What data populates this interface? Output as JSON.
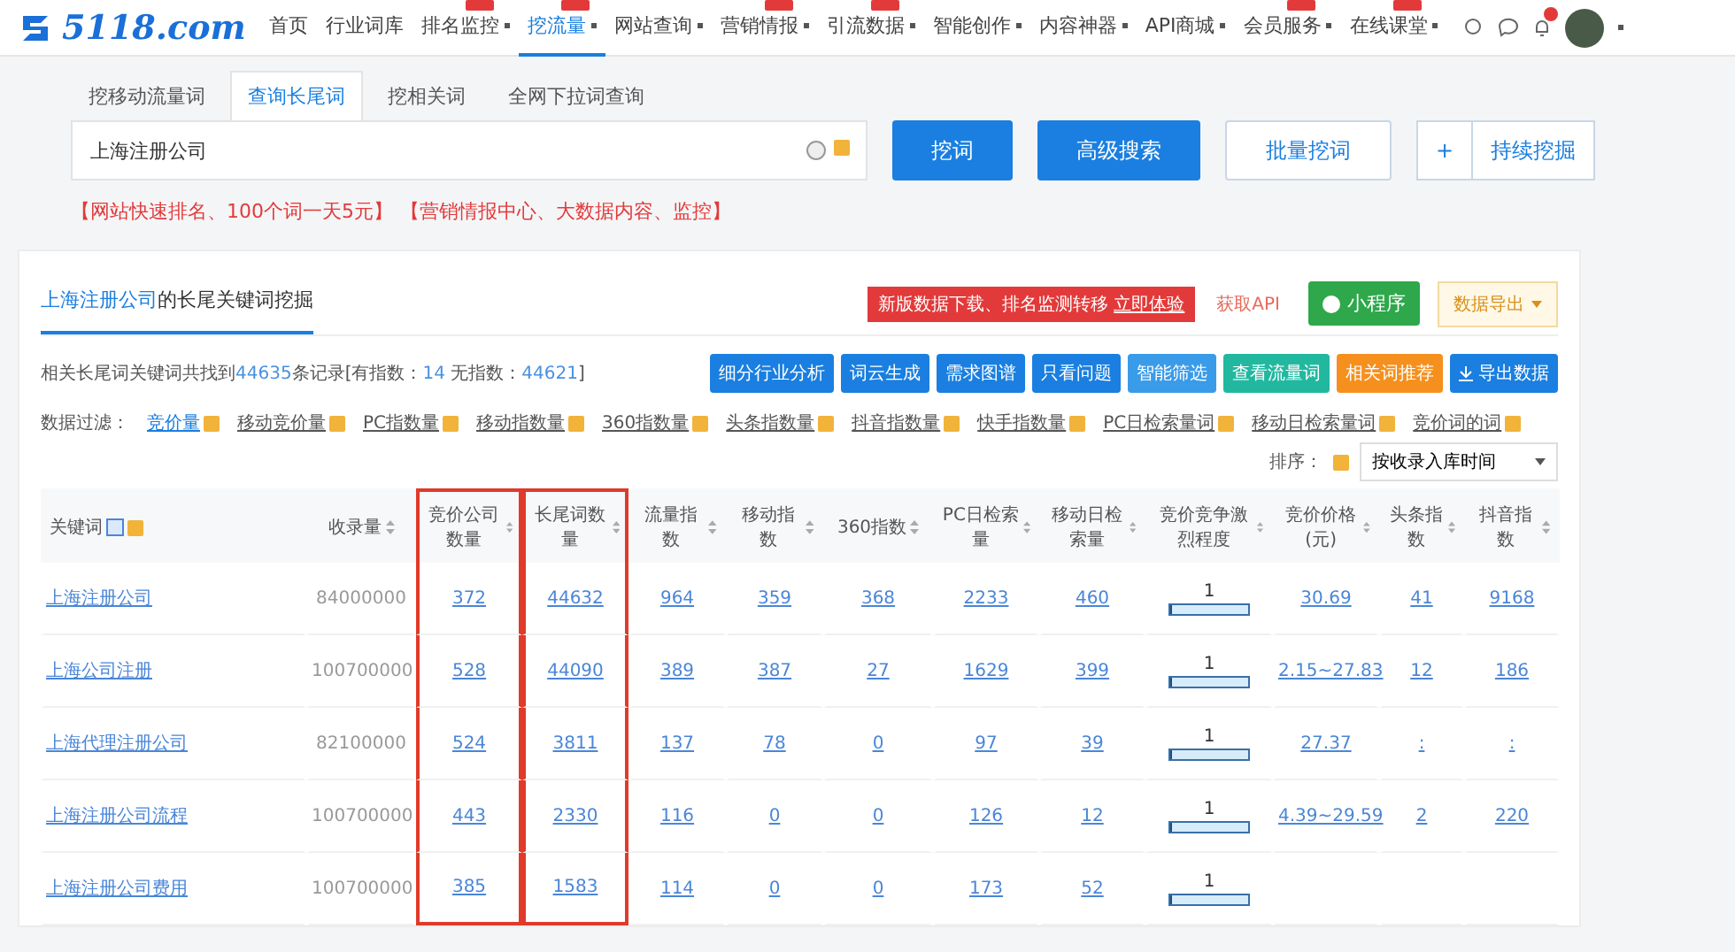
{
  "nav": {
    "logo": "5118.com",
    "items": [
      {
        "label": "首页",
        "dropdown": false,
        "badge": false,
        "selected": false
      },
      {
        "label": "行业词库",
        "dropdown": false,
        "badge": false,
        "selected": false
      },
      {
        "label": "排名监控",
        "dropdown": true,
        "badge": true,
        "selected": false
      },
      {
        "label": "挖流量",
        "dropdown": true,
        "badge": true,
        "selected": true
      },
      {
        "label": "网站查询",
        "dropdown": true,
        "badge": false,
        "selected": false
      },
      {
        "label": "营销情报",
        "dropdown": true,
        "badge": true,
        "selected": false
      },
      {
        "label": "引流数据",
        "dropdown": true,
        "badge": true,
        "selected": false
      },
      {
        "label": "智能创作",
        "dropdown": true,
        "badge": false,
        "selected": false
      },
      {
        "label": "内容神器",
        "dropdown": true,
        "badge": false,
        "selected": false
      },
      {
        "label": "API商城",
        "dropdown": true,
        "badge": false,
        "selected": false
      },
      {
        "label": "会员服务",
        "dropdown": true,
        "badge": true,
        "selected": false
      },
      {
        "label": "在线课堂",
        "dropdown": true,
        "badge": true,
        "selected": false
      }
    ]
  },
  "search_tabs": [
    {
      "label": "挖移动流量词",
      "selected": false
    },
    {
      "label": "查询长尾词",
      "selected": true
    },
    {
      "label": "挖相关词",
      "selected": false
    },
    {
      "label": "全网下拉词查询",
      "selected": false
    }
  ],
  "search": {
    "value": "上海注册公司",
    "buttons": [
      {
        "label": "挖词",
        "kind": "primary"
      },
      {
        "label": "高级搜索",
        "kind": "primary"
      },
      {
        "label": "批量挖词",
        "kind": "outline"
      }
    ],
    "add": "+",
    "continue": "持续挖掘"
  },
  "promo": [
    "【网站快速排名、100个词一天5元】",
    "【营销情报中心、大数据内容、监控】"
  ],
  "card": {
    "title_keyword": "上海注册公司",
    "title_rest": "的长尾关键词挖掘",
    "notice": "新版数据下载、排名监测转移",
    "notice_link": "立即体验",
    "api": "获取API",
    "mini": "小程序",
    "export_menu": "数据导出",
    "summary": {
      "prefix": "相关长尾词关键词共找到",
      "total": "44635",
      "middle": "条记录[有指数：",
      "indexed": "14",
      "middle2": "  无指数：",
      "unindexed": "44621",
      "suffix": "]"
    },
    "actions": [
      {
        "label": "细分行业分析",
        "color": "#1a7fe0"
      },
      {
        "label": "词云生成",
        "color": "#1a7fe0"
      },
      {
        "label": "需求图谱",
        "color": "#1a7fe0"
      },
      {
        "label": "只看问题",
        "color": "#1a7fe0"
      },
      {
        "label": "智能筛选",
        "color": "#3a9be8"
      },
      {
        "label": "查看流量词",
        "color": "#22b8a0"
      },
      {
        "label": "相关词推荐",
        "color": "#f5901e"
      },
      {
        "label": "导出数据",
        "color": "#1a7fe0"
      }
    ],
    "filter_label": "数据过滤：",
    "filters": [
      {
        "label": "竞价量",
        "selected": true
      },
      {
        "label": "移动竞价量",
        "selected": false
      },
      {
        "label": "PC指数量",
        "selected": false
      },
      {
        "label": "移动指数量",
        "selected": false
      },
      {
        "label": "360指数量",
        "selected": false
      },
      {
        "label": "头条指数量",
        "selected": false
      },
      {
        "label": "抖音指数量",
        "selected": false
      },
      {
        "label": "快手指数量",
        "selected": false
      },
      {
        "label": "PC日检索量词",
        "selected": false
      },
      {
        "label": "移动日检索量词",
        "selected": false
      },
      {
        "label": "竞价词的词",
        "selected": false
      }
    ],
    "sort_label": "排序：",
    "sort_value": "按收录入库时间"
  },
  "table": {
    "columns": [
      {
        "label": "关键词",
        "highlighted": false
      },
      {
        "label": "收录量",
        "highlighted": false
      },
      {
        "label": "竞价公司数量",
        "highlighted": true
      },
      {
        "label": "长尾词数量",
        "highlighted": true
      },
      {
        "label": "流量指数",
        "highlighted": false
      },
      {
        "label": "移动指数",
        "highlighted": false
      },
      {
        "label": "360指数",
        "highlighted": false
      },
      {
        "label": "PC日检索量",
        "highlighted": false
      },
      {
        "label": "移动日检索量",
        "highlighted": false
      },
      {
        "label": "竞价竞争激烈程度",
        "highlighted": false
      },
      {
        "label": "竞价价格(元)",
        "highlighted": false
      },
      {
        "label": "头条指数",
        "highlighted": false
      },
      {
        "label": "抖音指数",
        "highlighted": false
      }
    ],
    "rows": [
      {
        "cells": [
          "上海注册公司",
          "84000000",
          "372",
          "44632",
          "964",
          "359",
          "368",
          "2233",
          "460"
        ],
        "competition": {
          "value": "1",
          "level": 0.02
        },
        "tail": [
          "30.69",
          "41",
          "9168"
        ]
      },
      {
        "cells": [
          "上海公司注册",
          "100700000",
          "528",
          "44090",
          "389",
          "387",
          "27",
          "1629",
          "399"
        ],
        "competition": {
          "value": "1",
          "level": 0.02
        },
        "tail": [
          "2.15~27.83",
          "12",
          "186"
        ]
      },
      {
        "cells": [
          "上海代理注册公司",
          "82100000",
          "524",
          "3811",
          "137",
          "78",
          "0",
          "97",
          "39"
        ],
        "competition": {
          "value": "1",
          "level": 0.02
        },
        "tail": [
          "27.37",
          ":",
          ":"
        ]
      },
      {
        "cells": [
          "上海注册公司流程",
          "100700000",
          "443",
          "2330",
          "116",
          "0",
          "0",
          "126",
          "12"
        ],
        "competition": {
          "value": "1",
          "level": 0.02
        },
        "tail": [
          "4.39~29.59",
          "2",
          "220"
        ]
      },
      {
        "cells": [
          "上海注册公司费用",
          "100700000",
          "385",
          "1583",
          "114",
          "0",
          "0",
          "173",
          "52"
        ],
        "competition": {
          "value": "1",
          "level": 0.02
        },
        "tail": []
      }
    ]
  }
}
